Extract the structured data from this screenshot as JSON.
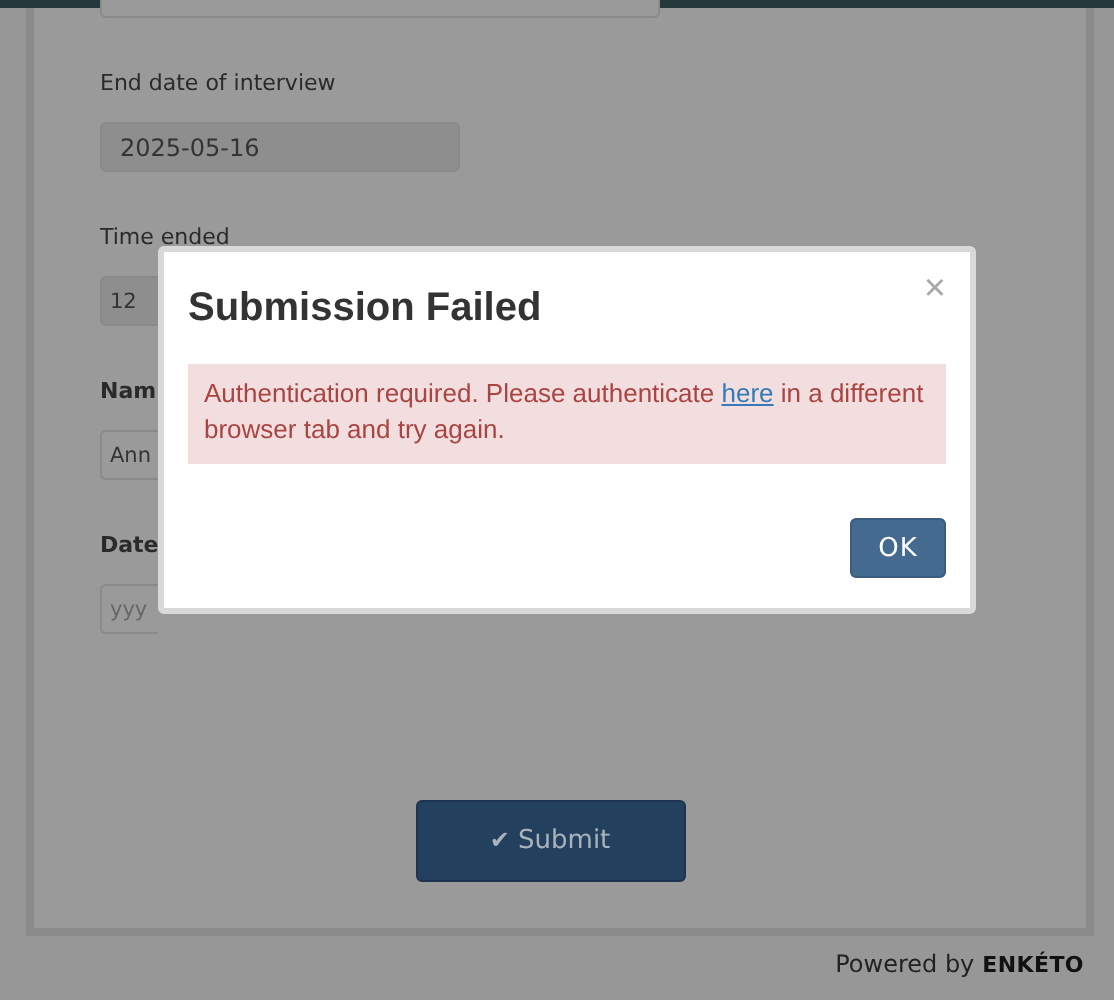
{
  "form": {
    "fields": [
      {
        "kind": "input",
        "readonly": false
      },
      {
        "kind": "input",
        "label": "End date of interview",
        "bold": false,
        "value": "2025-05-16",
        "readonly": true
      },
      {
        "kind": "input",
        "label": "Time ended",
        "bold": false,
        "value": "12",
        "readonly": true
      },
      {
        "kind": "input",
        "label": "Nam",
        "bold": true,
        "value": "Ann",
        "readonly": false
      },
      {
        "kind": "input",
        "label": "Date",
        "bold": true,
        "placeholder": "yyy",
        "readonly": false
      }
    ],
    "submit_button": {
      "icon": "✔",
      "label": "Submit"
    }
  },
  "footer": {
    "powered_by": "Powered by",
    "logo": "ENKÉTO"
  },
  "dialog": {
    "title": "Submission Failed",
    "close": "×",
    "alert": {
      "before": "Authentication required. Please authenticate ",
      "link": "here",
      "after": " in a different browser tab and try again."
    },
    "buttons": [
      "OK"
    ]
  }
}
